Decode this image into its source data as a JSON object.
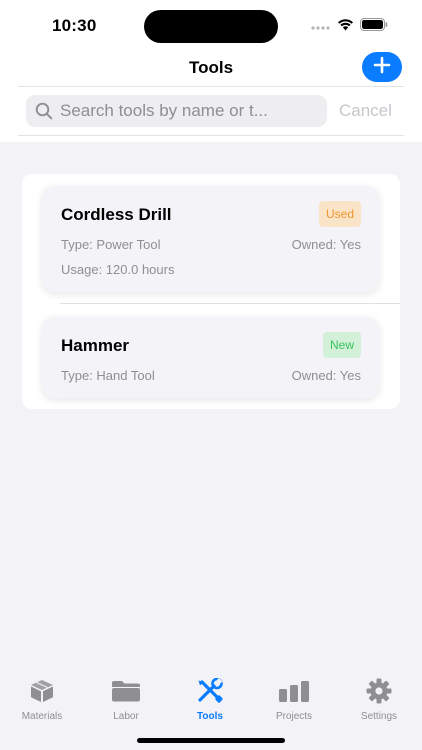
{
  "status": {
    "time": "10:30"
  },
  "nav": {
    "title": "Tools",
    "add_icon": "plus-icon"
  },
  "search": {
    "placeholder": "Search tools by name or t...",
    "value": "",
    "cancel_label": "Cancel"
  },
  "colors": {
    "accent": "#0a7cff",
    "used_badge": "#f0962d",
    "new_badge": "#37c25b"
  },
  "tools": [
    {
      "name": "Cordless Drill",
      "condition": "Used",
      "type": "Type: Power Tool",
      "owned": "Owned: Yes",
      "usage": "Usage: 120.0 hours"
    },
    {
      "name": "Hammer",
      "condition": "New",
      "type": "Type: Hand Tool",
      "owned": "Owned: Yes"
    }
  ],
  "tabs": [
    {
      "label": "Materials",
      "icon": "box-icon",
      "active": false
    },
    {
      "label": "Labor",
      "icon": "folder-icon",
      "active": false
    },
    {
      "label": "Tools",
      "icon": "wrench-screwdriver-icon",
      "active": true
    },
    {
      "label": "Projects",
      "icon": "chart-bars-icon",
      "active": false
    },
    {
      "label": "Settings",
      "icon": "gear-icon",
      "active": false
    }
  ]
}
